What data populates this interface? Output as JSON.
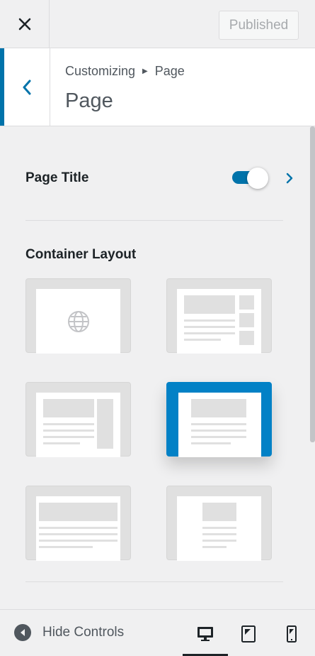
{
  "header": {
    "close_label": "Close",
    "publish_label": "Published"
  },
  "section": {
    "breadcrumb_parent": "Customizing",
    "breadcrumb_current": "Page",
    "title": "Page"
  },
  "page_title_control": {
    "label": "Page Title",
    "enabled": true
  },
  "container_layout": {
    "heading": "Container Layout",
    "options": [
      {
        "id": "default",
        "icon": "globe-icon",
        "selected": false
      },
      {
        "id": "content-right-sidebar-boxes",
        "selected": false
      },
      {
        "id": "content-with-sidebar",
        "selected": false
      },
      {
        "id": "boxed",
        "selected": true
      },
      {
        "id": "full-width",
        "selected": false
      },
      {
        "id": "narrow",
        "selected": false
      }
    ]
  },
  "footer": {
    "hide_controls_label": "Hide Controls",
    "devices": [
      "desktop",
      "tablet",
      "mobile"
    ],
    "active_device": "desktop"
  },
  "colors": {
    "accent": "#0073aa",
    "selected_card": "#0281c6"
  }
}
